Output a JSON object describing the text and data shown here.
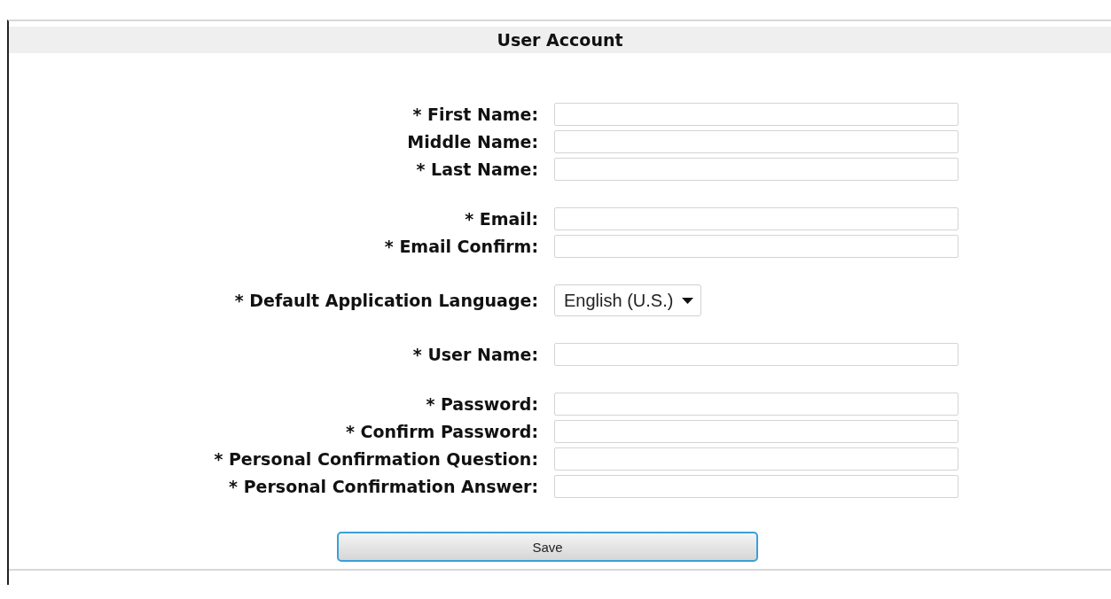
{
  "title": "User Account",
  "groups": [
    {
      "fields": [
        {
          "label": "* First Name:",
          "kind": "text"
        },
        {
          "label": "Middle Name:",
          "kind": "text"
        },
        {
          "label": "* Last Name:",
          "kind": "text"
        }
      ]
    },
    {
      "fields": [
        {
          "label": "* Email:",
          "kind": "text"
        },
        {
          "label": "* Email Confirm:",
          "kind": "text"
        }
      ]
    },
    {
      "fields": [
        {
          "label": "* Default Application Language:",
          "kind": "select",
          "value": "English (U.S.)"
        }
      ]
    },
    {
      "fields": [
        {
          "label": "* User Name:",
          "kind": "text"
        }
      ]
    },
    {
      "fields": [
        {
          "label": "* Password:",
          "kind": "text"
        },
        {
          "label": "* Confirm Password:",
          "kind": "text"
        },
        {
          "label": "* Personal Confirmation Question:",
          "kind": "text"
        },
        {
          "label": "* Personal Confirmation Answer:",
          "kind": "text"
        }
      ]
    }
  ],
  "save_button": "Save"
}
